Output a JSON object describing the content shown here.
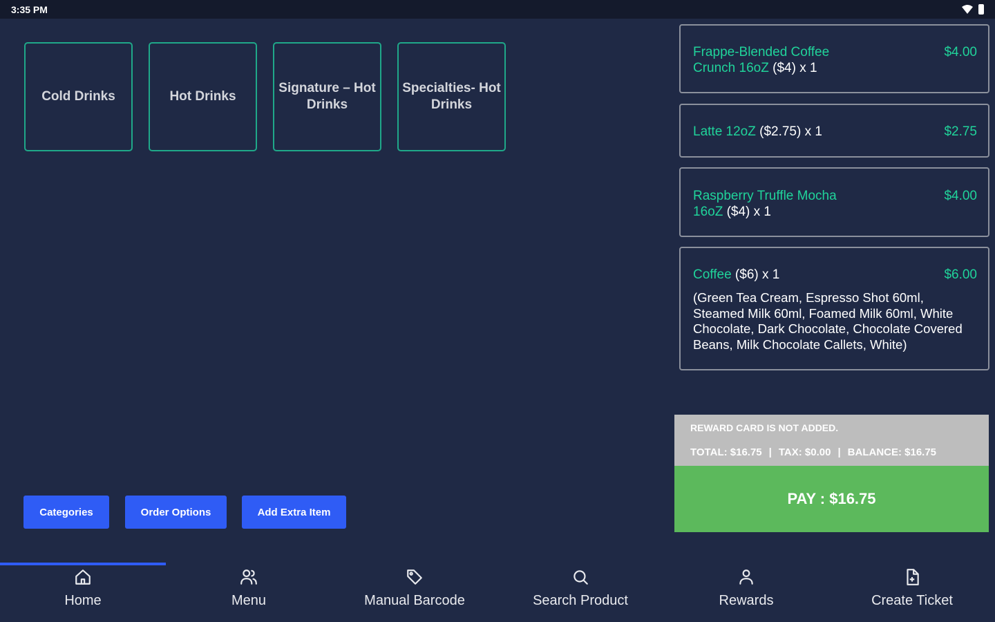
{
  "status_bar": {
    "time": "3:35 PM"
  },
  "categories": [
    {
      "label": "Cold Drinks"
    },
    {
      "label": "Hot Drinks"
    },
    {
      "label": "Signature – Hot Drinks"
    },
    {
      "label": "Specialties- Hot Drinks"
    }
  ],
  "actions": {
    "categories": "Categories",
    "order_options": "Order Options",
    "add_extra_item": "Add Extra Item"
  },
  "order_items": [
    {
      "name": "Frappe-Blended Coffee Crunch 16oZ",
      "suffix": " ($4) x 1",
      "price": "$4.00",
      "modifiers": ""
    },
    {
      "name": "Latte 12oZ",
      "suffix": " ($2.75) x 1",
      "price": "$2.75",
      "modifiers": ""
    },
    {
      "name": "Raspberry Truffle Mocha 16oZ",
      "suffix": " ($4) x 1",
      "price": "$4.00",
      "modifiers": ""
    },
    {
      "name": "Coffee",
      "suffix": " ($6) x 1",
      "price": "$6.00",
      "modifiers": "(Green Tea Cream, Espresso Shot 60ml, Steamed Milk 60ml, Foamed Milk 60ml, White Chocolate, Dark Chocolate, Chocolate Covered Beans, Milk Chocolate Callets, White)"
    }
  ],
  "summary": {
    "reward_notice": "REWARD CARD IS NOT ADDED.",
    "total": "TOTAL: $16.75",
    "tax": "TAX: $0.00",
    "balance": "BALANCE: $16.75",
    "separator": "|"
  },
  "pay_label": "PAY : $16.75",
  "nav": [
    {
      "label": "Home",
      "icon": "home-icon"
    },
    {
      "label": "Menu",
      "icon": "users-icon"
    },
    {
      "label": "Manual Barcode",
      "icon": "tag-icon"
    },
    {
      "label": "Search Product",
      "icon": "search-icon"
    },
    {
      "label": "Rewards",
      "icon": "user-icon"
    },
    {
      "label": "Create Ticket",
      "icon": "file-icon"
    }
  ],
  "colors": {
    "background": "#1f2945",
    "accent_blue": "#2f5cf5",
    "accent_teal": "#1fa889",
    "item_green": "#20d39a",
    "pay_green": "#5cb95c"
  }
}
